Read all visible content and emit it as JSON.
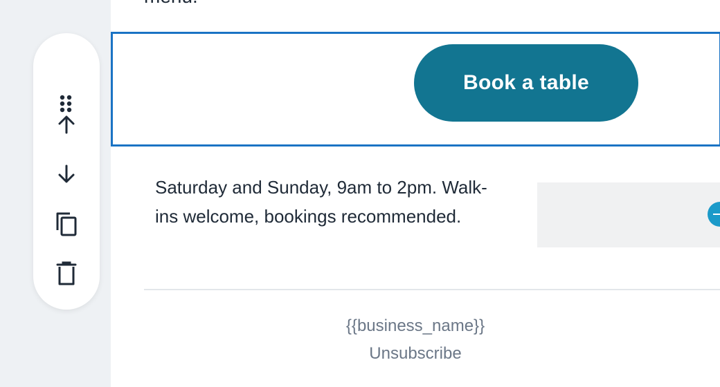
{
  "previous_block": {
    "text_fragment": "menu."
  },
  "toolbar": {
    "items": [
      {
        "icon": "drag-handle-icon",
        "action": "Drag"
      },
      {
        "icon": "arrow-up-icon",
        "action": "Move up"
      },
      {
        "icon": "arrow-down-icon",
        "action": "Move down"
      },
      {
        "icon": "duplicate-icon",
        "action": "Duplicate"
      },
      {
        "icon": "trash-icon",
        "action": "Delete"
      }
    ]
  },
  "button_block": {
    "label": "Book a table",
    "color": "#127591",
    "selected_border_color": "#1a73c4"
  },
  "info_block": {
    "text": "Saturday and Sunday, 9am to 2pm. Walk-ins welcome, bookings recommended.",
    "add_icon": "add-circle-icon",
    "add_color": "#1b9ac9"
  },
  "footer": {
    "business_name": "{{business_name}}",
    "unsubscribe": "Unsubscribe"
  }
}
